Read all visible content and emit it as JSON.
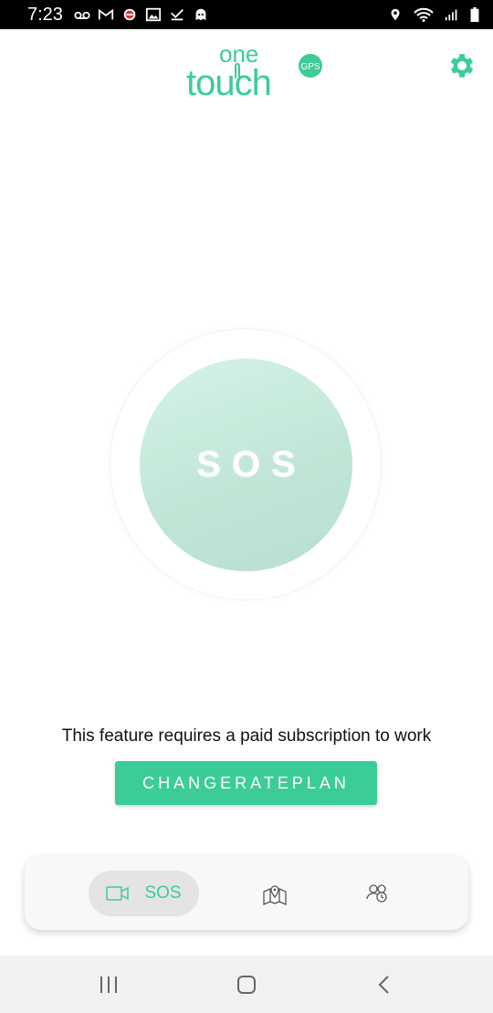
{
  "status_bar": {
    "time": "7:23",
    "left_icons": [
      "voicemail-icon",
      "gmail-icon",
      "app-notification-icon",
      "image-icon",
      "download-done-icon",
      "ghost-icon"
    ],
    "right_icons": [
      "location-icon",
      "wifi-icon",
      "signal-icon",
      "battery-icon"
    ]
  },
  "header": {
    "logo": {
      "text_top": "one",
      "text_bottom": "touch",
      "badge": "GPS"
    },
    "settings_icon": "gear-icon"
  },
  "sos": {
    "label": "SOS"
  },
  "subscription": {
    "notice": "This feature requires a paid subscription to work",
    "button_label": "CHANGERATEPLAN"
  },
  "bottom_nav": {
    "items": [
      {
        "label": "SOS",
        "icon": "video-camera-icon",
        "active": true
      },
      {
        "icon": "map-pin-icon"
      },
      {
        "icon": "group-icon"
      }
    ]
  },
  "colors": {
    "accent": "#3ccc98",
    "sos_circle": "#c8ecdf",
    "nav_background": "#f8f8f8",
    "nav_active_pill": "#e4e4e4"
  }
}
